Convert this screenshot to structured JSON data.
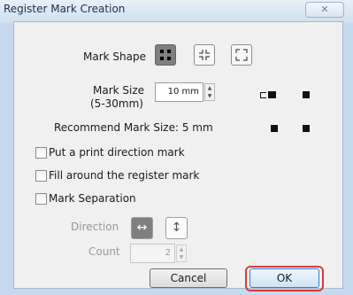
{
  "window": {
    "title": "Register Mark Creation",
    "close_glyph": "✕"
  },
  "mark_shape": {
    "label": "Mark Shape",
    "options": [
      "square-corners",
      "inner-corners",
      "outer-corners"
    ],
    "selected": "square-corners"
  },
  "mark_size": {
    "label_line1": "Mark Size",
    "label_line2": "(5-30mm)",
    "value": "10 mm"
  },
  "recommend": {
    "text": "Recommend Mark Size:  5 mm"
  },
  "checkboxes": {
    "print_direction": {
      "label": "Put a print direction mark",
      "checked": false
    },
    "fill_around": {
      "label": "Fill around the register mark",
      "checked": false
    },
    "mark_separation": {
      "label": "Mark Separation",
      "checked": false
    }
  },
  "direction": {
    "label": "Direction",
    "options": [
      "↔",
      "↕"
    ],
    "selected": "↔"
  },
  "count": {
    "label": "Count",
    "value": "2"
  },
  "buttons": {
    "cancel": "Cancel",
    "ok": "OK"
  },
  "colors": {
    "highlight": "#d93b3b",
    "selected_button": "#7f7f7f"
  }
}
